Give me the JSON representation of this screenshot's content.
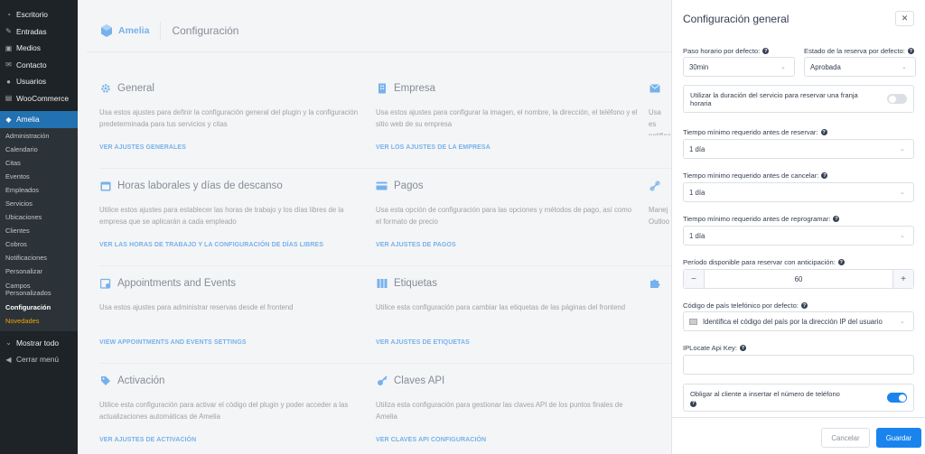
{
  "wp_menu": {
    "top": [
      {
        "label": "Escritorio",
        "icon": "dashboard-icon"
      },
      {
        "label": "Entradas",
        "icon": "pin-icon"
      },
      {
        "label": "Medios",
        "icon": "media-icon"
      },
      {
        "label": "Contacto",
        "icon": "mail-icon"
      },
      {
        "label": "Usuarios",
        "icon": "users-icon"
      },
      {
        "label": "WooCommerce",
        "icon": "woocommerce-icon"
      }
    ],
    "amelia": "Amelia",
    "sub": [
      "Administración",
      "Calendario",
      "Citas",
      "Eventos",
      "Empleados",
      "Servicios",
      "Ubicaciones",
      "Clientes",
      "Cobros",
      "Notificaciones",
      "Personalizar",
      "Campos Personalizados",
      "Configuración",
      "Novedades"
    ],
    "show_all": "Mostrar todo",
    "collapse": "Cerrar menú"
  },
  "header": {
    "brand": "Amelia",
    "title": "Configuración"
  },
  "cards": [
    {
      "title": "General",
      "desc": "Usa estos ajustes para definir la configuración general del plugin y la configuración predeterminada para tus servicios y citas",
      "link": "VER AJUSTES GENERALES",
      "icon": "gear-icon"
    },
    {
      "title": "Empresa",
      "desc": "Usa estos ajustes para configurar la imagen, el nombre, la dirección, el teléfono y el sitio web de su empresa",
      "link": "VER LOS AJUSTES DE LA EMPRESA",
      "icon": "building-icon"
    },
    {
      "title": "Horas laborales y días de descanso",
      "desc": "Utilice estos ajustes para establecer las horas de trabajo y los días libres de la empresa que se aplicarán a cada empleado",
      "link": "VER LAS HORAS DE TRABAJO Y LA CONFIGURACIÓN DE DÍAS LIBRES",
      "icon": "calendar-icon"
    },
    {
      "title": "Pagos",
      "desc": "Usa esta opción de configuración para las opciones y métodos de pago, así como el formato de precio",
      "link": "VER AJUSTES DE PAGOS",
      "icon": "credit-card-icon"
    },
    {
      "title": "Appointments and Events",
      "desc": "Usa estos ajustes para administrar reservas desde el frontend",
      "link": "VIEW APPOINTMENTS AND EVENTS SETTINGS",
      "icon": "calendar-gear-icon"
    },
    {
      "title": "Etiquetas",
      "desc": "Utilice esta configuración para cambiar las etiquetas de las páginas del frontend",
      "link": "VER AJUSTES DE ETIQUETAS",
      "icon": "books-icon"
    },
    {
      "title": "Activación",
      "desc": "Utilice esta configuración para activar el código del plugin y poder acceder a las actualizaciones automáticas de Amelia",
      "link": "VER AJUSTES DE ACTIVACIÓN",
      "icon": "tag-icon"
    },
    {
      "title": "Claves API",
      "desc": "Utiliza esta configuración para gestionar las claves API de los puntos finales de Amelia",
      "link": "VER CLAVES API CONFIGURACIÓN",
      "icon": "key-icon"
    }
  ],
  "third_col": [
    {
      "desc": "Usa es notifica",
      "icon": "mail-icon"
    },
    {
      "desc": "Manej Outloo",
      "icon": "link-icon"
    },
    {
      "desc": "",
      "icon": "puzzle-icon"
    }
  ],
  "panel": {
    "title": "Configuración general",
    "close_icon": "close-icon",
    "time_step_label": "Paso horario por defecto:",
    "time_step_value": "30min",
    "status_label": "Estado de la reserva por defecto:",
    "status_value": "Aprobada",
    "duration_toggle_label": "Utilizar la duración del servicio para reservar una franja horaria",
    "duration_toggle_on": false,
    "min_before_booking_label": "Tiempo mínimo requerido antes de reservar:",
    "min_before_booking_value": "1 día",
    "min_before_cancel_label": "Tiempo mínimo requerido antes de cancelar:",
    "min_before_cancel_value": "1 día",
    "min_before_reschedule_label": "Tiempo mínimo requerido antes de reprogramar:",
    "min_before_reschedule_value": "1 día",
    "advance_label": "Período disponible para reservar con anticipación:",
    "advance_value": "60",
    "minus": "−",
    "plus": "+",
    "country_label": "Código de país telefónico por defecto:",
    "country_value": "Identifica el código del país por la dirección IP del usuario",
    "iplocate_label": "IPLocate Api Key:",
    "iplocate_value": "",
    "phone_toggle_label": "Obligar al cliente a insertar el número de teléfono",
    "phone_toggle_on": true,
    "cancel": "Cancelar",
    "save": "Guardar"
  },
  "colors": {
    "accent": "#1a84ee",
    "wp_sidebar": "#1d2327",
    "wp_active": "#2271b1"
  }
}
